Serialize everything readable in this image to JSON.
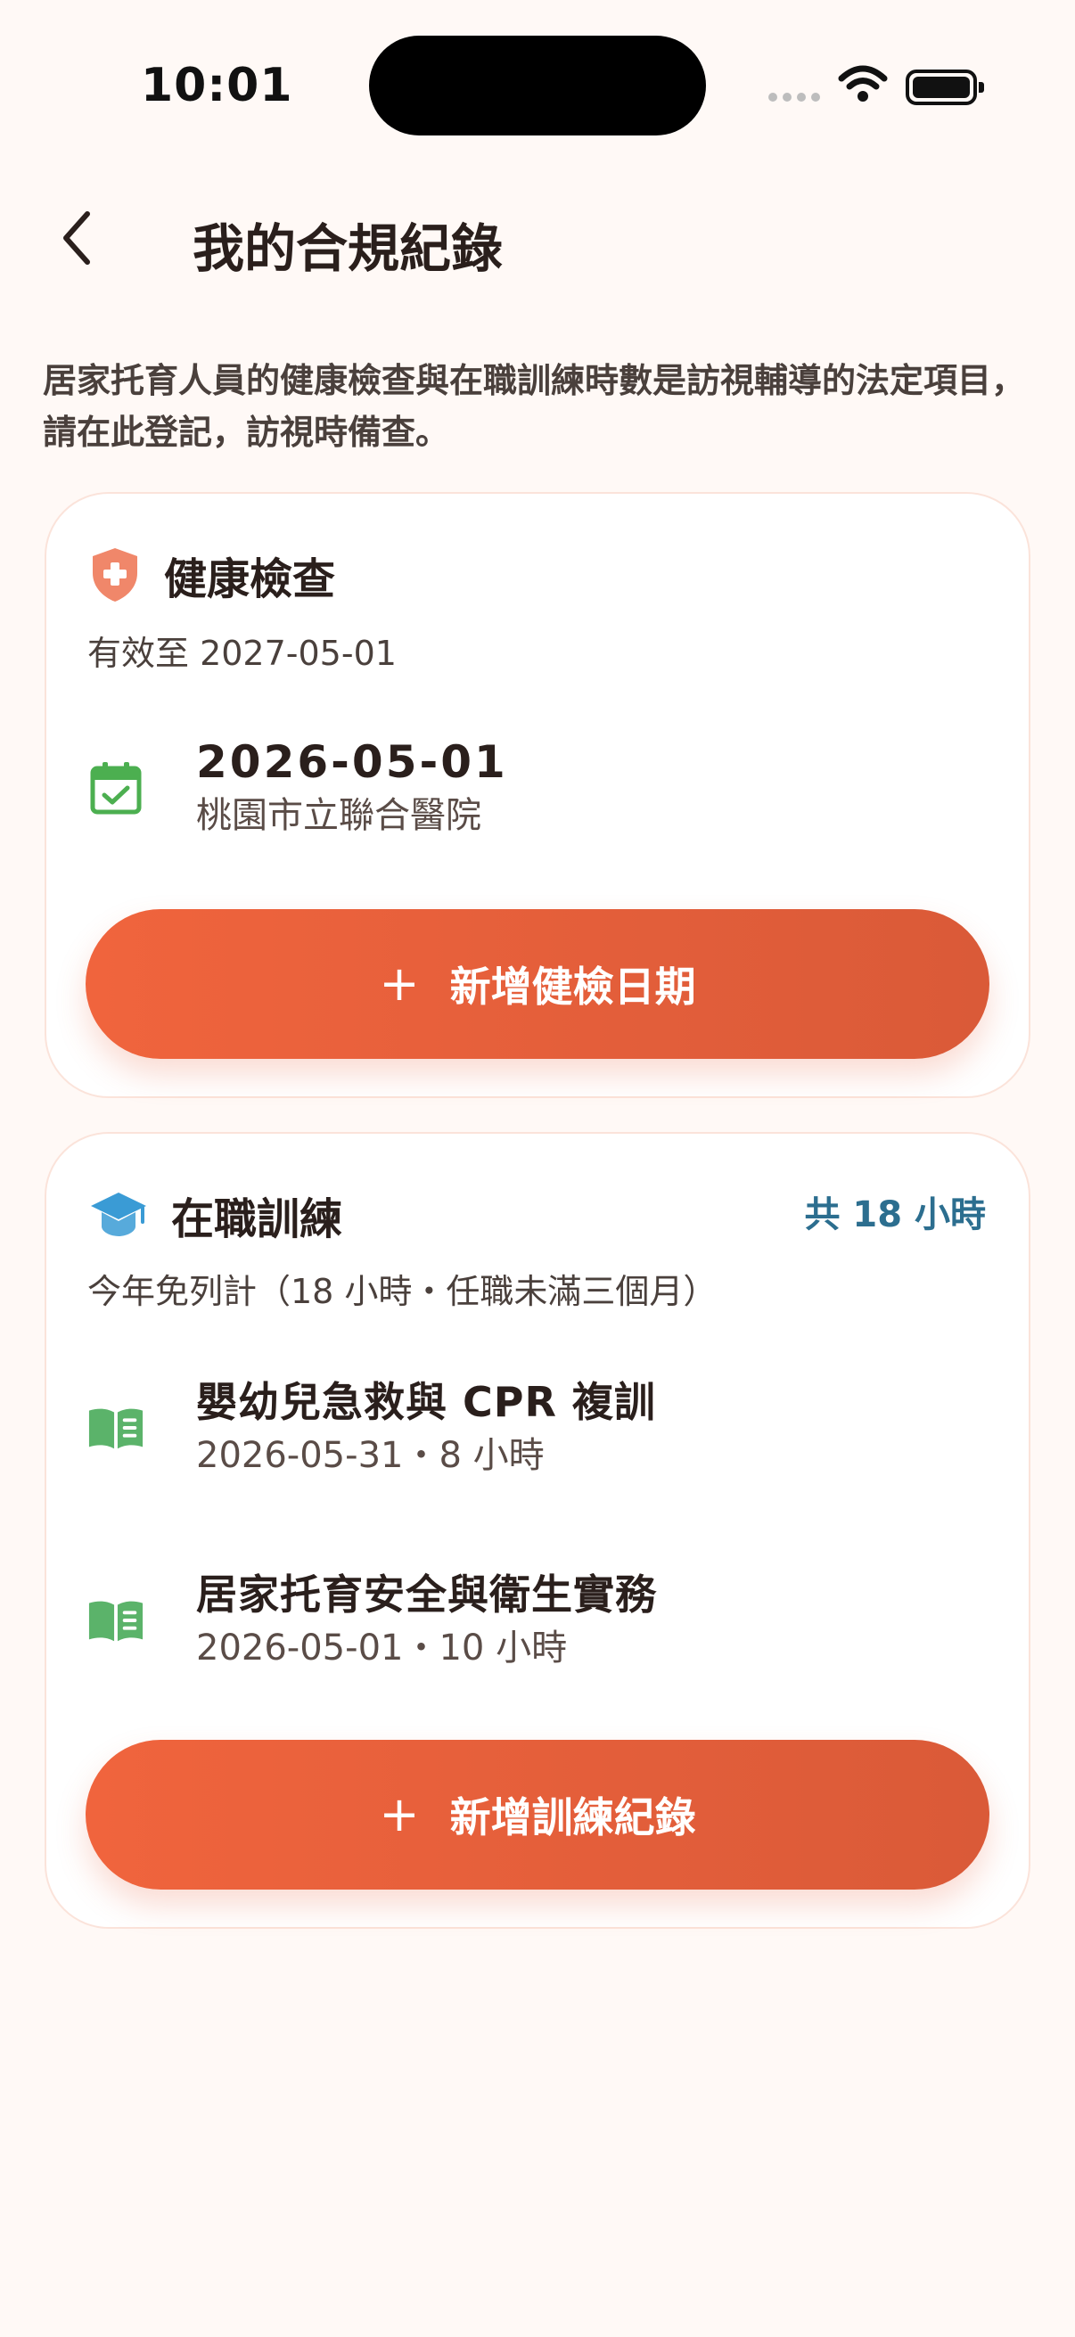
{
  "status_bar": {
    "time": "10:01"
  },
  "header": {
    "title": "我的合規紀錄"
  },
  "intro": "居家托育人員的健康檢查與在職訓練時數是訪視輔導的法定項目，請在此登記，訪視時備查。",
  "health": {
    "title": "健康檢查",
    "valid_until": "有效至 2027-05-01",
    "record": {
      "date": "2026-05-01",
      "place": "桃園市立聯合醫院"
    },
    "add_button": "新增健檢日期",
    "colors": {
      "icon": "#F0876A",
      "calendar": "#4CAF50"
    }
  },
  "training": {
    "title": "在職訓練",
    "total": "共 18 小時",
    "note": "今年免列計（18 小時・任職未滿三個月）",
    "items": [
      {
        "name": "嬰幼兒急救與 CPR 複訓",
        "meta": "2026-05-31・8 小時"
      },
      {
        "name": "居家托育安全與衛生實務",
        "meta": "2026-05-01・10 小時"
      }
    ],
    "add_button": "新增訓練紀錄",
    "colors": {
      "icon": "#3A9BD5",
      "book": "#5BB36A",
      "total": "#2C6E8F"
    }
  },
  "colors": {
    "accent": "#E8603C",
    "background": "#FFF9F6"
  }
}
